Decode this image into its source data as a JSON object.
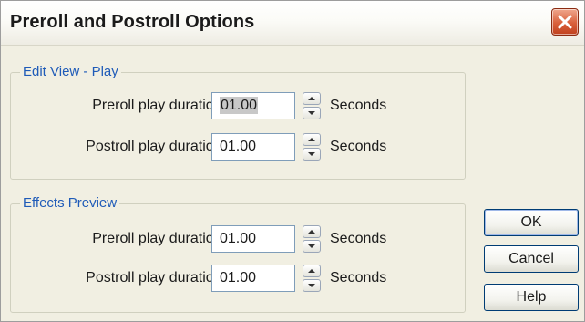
{
  "window": {
    "title": "Preroll and Postroll Options",
    "close_icon": "close-icon"
  },
  "groups": [
    {
      "legend": "Edit View - Play",
      "rows": [
        {
          "label": "Preroll play duration:",
          "value": "01.00",
          "unit": "Seconds",
          "selected": true
        },
        {
          "label": "Postroll play duration:",
          "value": "01.00",
          "unit": "Seconds",
          "selected": false
        }
      ]
    },
    {
      "legend": "Effects Preview",
      "rows": [
        {
          "label": "Preroll play duration:",
          "value": "01.00",
          "unit": "Seconds",
          "selected": false
        },
        {
          "label": "Postroll play duration:",
          "value": "01.00",
          "unit": "Seconds",
          "selected": false
        }
      ]
    }
  ],
  "buttons": {
    "ok": "OK",
    "cancel": "Cancel",
    "help": "Help"
  },
  "colors": {
    "legend_text": "#1f5bb8",
    "close_button": "#d9603b"
  }
}
